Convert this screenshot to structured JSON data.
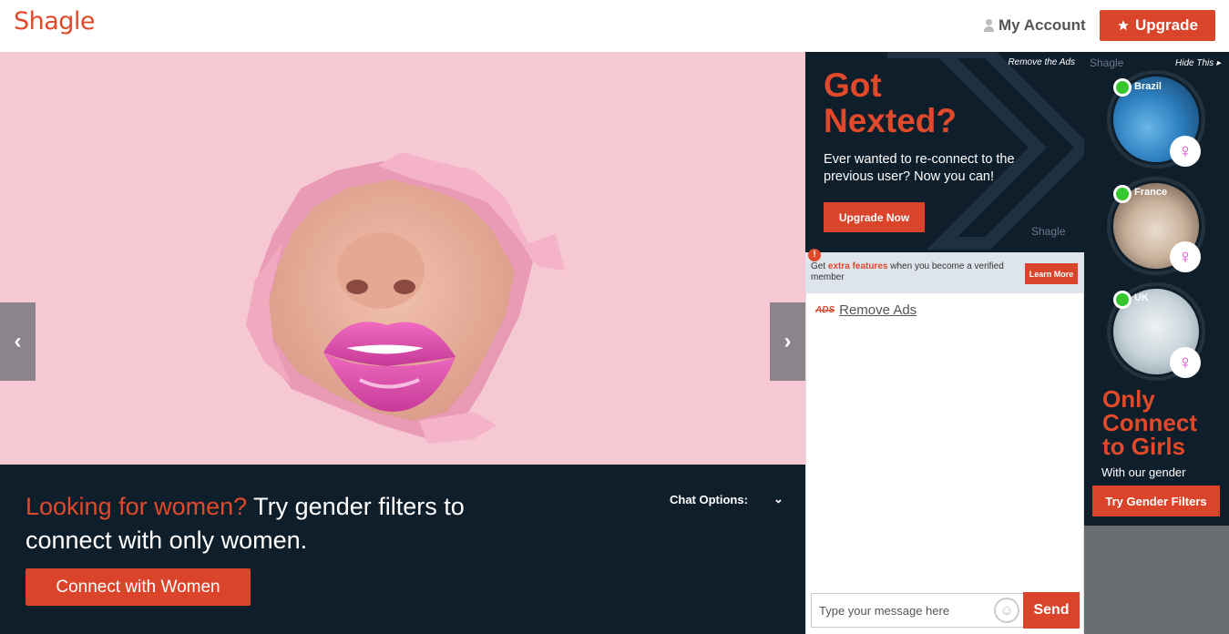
{
  "header": {
    "logo": "Shagle",
    "account_label": "My Account",
    "upgrade_label": "Upgrade"
  },
  "hero": {
    "prev_label": "‹",
    "next_label": "›"
  },
  "promo": {
    "highlight": "Looking for women?",
    "text": " Try gender filters to connect with only women.",
    "button": "Connect with Women",
    "chat_options": "Chat Options:",
    "chat_options_arrow": "⌄"
  },
  "ad_mid": {
    "remove": "Remove the Ads",
    "title_line1": "Got",
    "title_line2": "Nexted?",
    "subtitle": "Ever wanted to re-connect to the previous user? Now you can!",
    "button": "Upgrade Now",
    "brand": "Shagle"
  },
  "notice": {
    "icon": "!",
    "pre": "Get ",
    "highlight": "extra features",
    "post": " when you become a verified member",
    "button": "Learn More"
  },
  "chat": {
    "ads_icon": "ADS",
    "remove_ads": "Remove Ads",
    "input_placeholder": "Type your message here",
    "emoji": "☺",
    "send": "Send"
  },
  "ad_right": {
    "brand": "Shagle",
    "hide": "Hide This ▸",
    "users": [
      {
        "country": "Brazil"
      },
      {
        "country": "France"
      },
      {
        "country": "UK"
      }
    ],
    "female_symbol": "♀",
    "title_line1": "Only",
    "title_line2": "Connect",
    "title_line3": "to Girls",
    "subtitle": "With our gender",
    "button": "Try Gender Filters"
  },
  "colors": {
    "accent": "#d9442a",
    "dark_navy": "#0f1e2b",
    "hero_pink": "#f6c8d3",
    "online_green": "#36c72f"
  }
}
